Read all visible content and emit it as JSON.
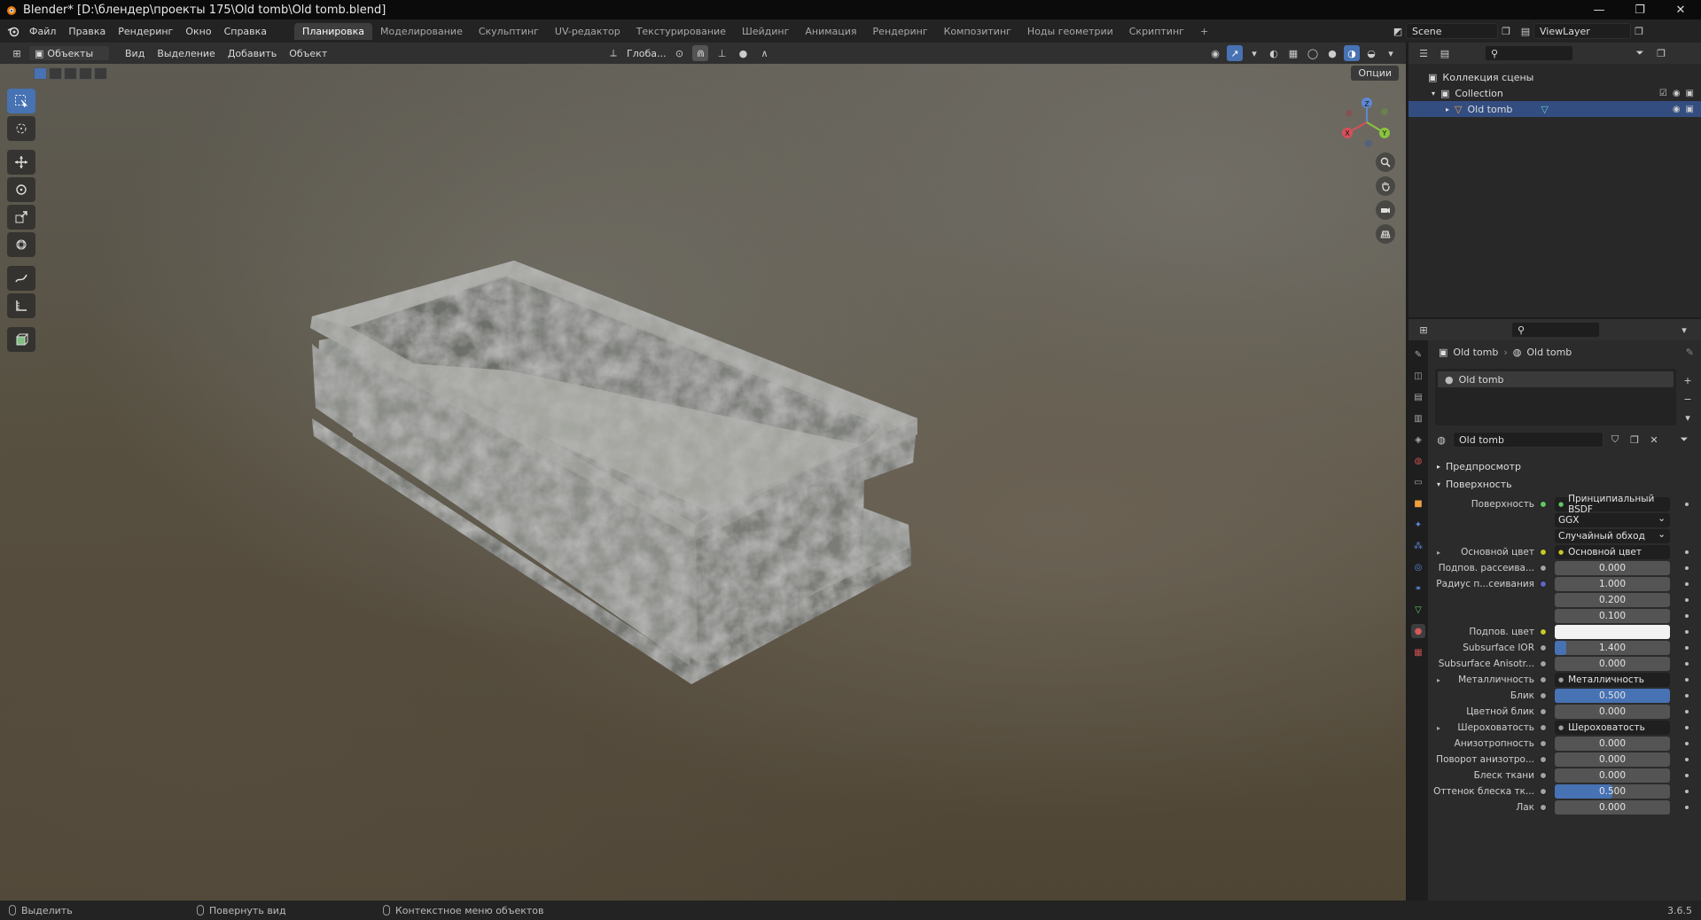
{
  "titlebar": {
    "title": "Blender* [D:\\блендер\\проекты 175\\Old tomb\\Old tomb.blend]",
    "min": "—",
    "max": "❐",
    "close": "✕"
  },
  "menu": [
    "Файл",
    "Правка",
    "Рендеринг",
    "Окно",
    "Справка"
  ],
  "workspaces": [
    "Планировка",
    "Моделирование",
    "Скульптинг",
    "UV-редактор",
    "Текстурирование",
    "Шейдинг",
    "Анимация",
    "Рендеринг",
    "Композитинг",
    "Ноды геометрии",
    "Скриптинг"
  ],
  "workspace_add": "+",
  "scene": {
    "name": "Scene",
    "viewlayer": "ViewLayer"
  },
  "viewport_header": {
    "mode": "Объекты",
    "menu": [
      "Вид",
      "Выделение",
      "Добавить",
      "Объект"
    ],
    "transform_orientation": "Глоба...",
    "options": "Опции"
  },
  "gizmo": {
    "z": "Z",
    "x": "X",
    "y": "Y"
  },
  "status": {
    "select": "Выделить",
    "rotate": "Повернуть вид",
    "context": "Контекстное меню объектов",
    "version": "3.6.5"
  },
  "outliner": {
    "scene_collection": "Коллекция сцены",
    "collection": "Collection",
    "object": "Old tomb"
  },
  "properties": {
    "breadcrumb_object": "Old tomb",
    "breadcrumb_material": "Old tomb",
    "slot": "Old tomb",
    "material_name": "Old tomb",
    "panel_preview": "Предпросмотр",
    "panel_surface": "Поверхность",
    "rows": [
      {
        "label": "Поверхность",
        "value": "Принципиальный BSDF",
        "kind": "node",
        "sock": "#63c763"
      },
      {
        "label": "",
        "value": "GGX",
        "kind": "dd"
      },
      {
        "label": "",
        "value": "Случайный обход",
        "kind": "dd"
      },
      {
        "label": "Основной цвет",
        "value": "Основной цвет",
        "kind": "node",
        "sock": "#c7c729",
        "arrow": "▸"
      },
      {
        "label": "Подпов. рассеива...",
        "value": "0.000",
        "kind": "num",
        "sock": "#a1a1a1"
      },
      {
        "label": "Радиус п...сеивания",
        "value": "1.000",
        "kind": "num",
        "sock": "#6363c7"
      },
      {
        "label": "",
        "value": "0.200",
        "kind": "num"
      },
      {
        "label": "",
        "value": "0.100",
        "kind": "num"
      },
      {
        "label": "Подпов. цвет",
        "value": "",
        "kind": "color",
        "sock": "#c7c729"
      },
      {
        "label": "Subsurface IOR",
        "value": "1.400",
        "kind": "num",
        "fill": 0.1,
        "sock": "#a1a1a1"
      },
      {
        "label": "Subsurface Anisotr...",
        "value": "0.000",
        "kind": "num",
        "sock": "#a1a1a1"
      },
      {
        "label": "Металличность",
        "value": "Металличность",
        "kind": "node",
        "sock": "#a1a1a1",
        "arrow": "▸"
      },
      {
        "label": "Блик",
        "value": "0.500",
        "kind": "num",
        "fill": 1.0,
        "sock": "#a1a1a1"
      },
      {
        "label": "Цветной блик",
        "value": "0.000",
        "kind": "num",
        "sock": "#a1a1a1"
      },
      {
        "label": "Шероховатость",
        "value": "Шероховатость",
        "kind": "node",
        "sock": "#a1a1a1",
        "arrow": "▸"
      },
      {
        "label": "Анизотропность",
        "value": "0.000",
        "kind": "num",
        "sock": "#a1a1a1"
      },
      {
        "label": "Поворот анизотро...",
        "value": "0.000",
        "kind": "num",
        "sock": "#a1a1a1"
      },
      {
        "label": "Блеск ткани",
        "value": "0.000",
        "kind": "num",
        "sock": "#a1a1a1"
      },
      {
        "label": "Оттенок блеска тк...",
        "value": "0.500",
        "kind": "num",
        "fill": 0.5,
        "sock": "#a1a1a1"
      },
      {
        "label": "Лак",
        "value": "0.000",
        "kind": "num",
        "sock": "#a1a1a1"
      }
    ]
  },
  "colors": {
    "accent": "#4772b3",
    "selection": "#334d80",
    "panel": "#2b2b2b"
  }
}
